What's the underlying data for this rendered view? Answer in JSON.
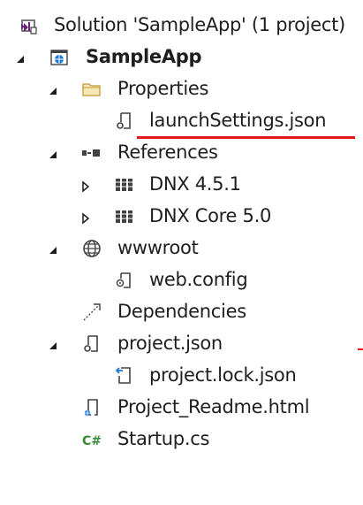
{
  "solution_explorer": {
    "items": [
      {
        "label": "Solution 'SampleApp' (1 project)",
        "icon": "visual-studio-solution-icon"
      },
      {
        "label": "SampleApp",
        "icon": "web-project-globe-icon",
        "expanded": true
      },
      {
        "label": "Properties",
        "icon": "folder-icon",
        "expanded": true
      },
      {
        "label": "launchSettings.json",
        "icon": "json-file-icon"
      },
      {
        "label": "References",
        "icon": "references-icon",
        "expanded": true
      },
      {
        "label": "DNX 4.5.1",
        "icon": "library-icon",
        "expanded": false
      },
      {
        "label": "DNX Core 5.0",
        "icon": "library-icon",
        "expanded": false
      },
      {
        "label": "wwwroot",
        "icon": "globe-icon",
        "expanded": true
      },
      {
        "label": "web.config",
        "icon": "config-file-icon"
      },
      {
        "label": "Dependencies",
        "icon": "dependencies-icon"
      },
      {
        "label": "project.json",
        "icon": "json-file-icon",
        "expanded": true
      },
      {
        "label": "project.lock.json",
        "icon": "lock-json-file-icon"
      },
      {
        "label": "Project_Readme.html",
        "icon": "html-file-icon"
      },
      {
        "label": "Startup.cs",
        "icon": "csharp-file-icon"
      }
    ]
  },
  "colors": {
    "annotation_underline": "#e8141c",
    "text": "#1e1e1e",
    "vs_purple": "#68217a",
    "csharp_green": "#388a34",
    "globe_blue": "#1e7ad6"
  }
}
